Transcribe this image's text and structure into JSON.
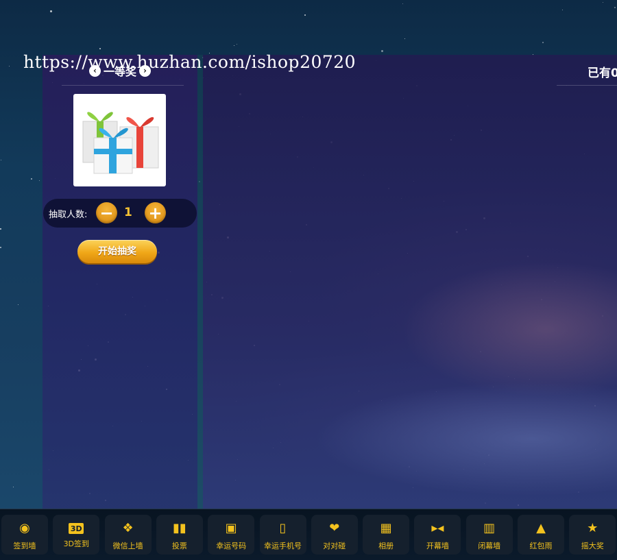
{
  "watermark": "https://www.huzhan.com/ishop20720",
  "prize": {
    "title": "一等奖",
    "prev_icon": "chevron-left-icon",
    "next_icon": "chevron-right-icon",
    "image": "gift-boxes-image"
  },
  "draw": {
    "count_label": "抽取人数:",
    "count_value": "1",
    "minus_icon": "minus-icon",
    "plus_icon": "plus-icon",
    "start_label": "开始抽奖"
  },
  "participants_text": "已有0",
  "toolbar": {
    "items": [
      {
        "label": "签到墙",
        "icon": "map-pin-icon"
      },
      {
        "label": "3D签到",
        "icon": "3d-icon"
      },
      {
        "label": "微信上墙",
        "icon": "wechat-icon"
      },
      {
        "label": "投票",
        "icon": "bar-chart-icon"
      },
      {
        "label": "幸运号码",
        "icon": "lucky-number-icon"
      },
      {
        "label": "幸运手机号",
        "icon": "phone-icon"
      },
      {
        "label": "对对碰",
        "icon": "heart-pair-icon"
      },
      {
        "label": "相册",
        "icon": "photo-icon"
      },
      {
        "label": "开幕墙",
        "icon": "curtain-open-icon"
      },
      {
        "label": "闭幕墙",
        "icon": "curtain-close-icon"
      },
      {
        "label": "红包雨",
        "icon": "red-packet-icon"
      },
      {
        "label": "摇大奖",
        "icon": "trophy-icon"
      }
    ]
  },
  "colors": {
    "accent": "#f3c21e",
    "button_orange": "#f0a718",
    "panel": "#2a2a6e"
  }
}
